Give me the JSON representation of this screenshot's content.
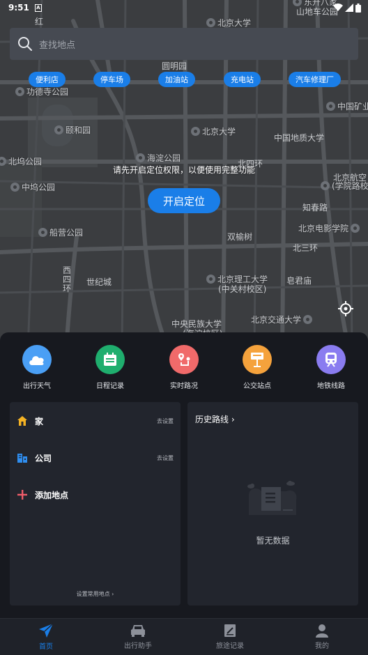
{
  "status_bar": {
    "time": "9:51",
    "app_badge": "A"
  },
  "search": {
    "placeholder": "查找地点"
  },
  "categories": [
    "便利店",
    "停车场",
    "加油站",
    "充电站",
    "汽车修理厂"
  ],
  "map": {
    "labels": [
      "东升八家",
      "山地车公园",
      "北京大学",
      "圆明园",
      "功德寺公园",
      "中国矿业",
      "颐和园",
      "北京大学",
      "中国地质大学",
      "北坞公园",
      "海淀公园",
      "北四环",
      "北京航空",
      "(学院路校",
      "中坞公园",
      "知春路",
      "船营公园",
      "北京电影学院",
      "双榆树",
      "北三环",
      "西四环",
      "世纪城",
      "北京理工大学",
      "(中关村校区)",
      "皂君庙",
      "中央民族大学",
      "(海淀校区)",
      "北京交通大学",
      "红"
    ]
  },
  "permission": {
    "message": "请先开启定位权限，以便使用完整功能",
    "button": "开启定位"
  },
  "quick_actions": [
    {
      "label": "出行天气",
      "icon": "cloud-icon",
      "color": "#4a9ff5"
    },
    {
      "label": "日程记录",
      "icon": "calendar-icon",
      "color": "#1fae6e"
    },
    {
      "label": "实时路况",
      "icon": "route-icon",
      "color": "#f06a6a"
    },
    {
      "label": "公交站点",
      "icon": "bus-stop-icon",
      "color": "#f5a23c"
    },
    {
      "label": "地铁线路",
      "icon": "subway-icon",
      "color": "#8a7cf0"
    }
  ],
  "places": {
    "home": {
      "label": "家",
      "action": "去设置"
    },
    "company": {
      "label": "公司",
      "action": "去设置"
    },
    "add": {
      "label": "添加地点"
    },
    "footer": "设置常用地点 ›"
  },
  "history": {
    "title": "历史路线 ›",
    "empty": "暂无数据"
  },
  "nav": [
    {
      "label": "首页",
      "icon": "paper-plane-icon",
      "active": true
    },
    {
      "label": "出行助手",
      "icon": "car-icon",
      "active": false
    },
    {
      "label": "旅途记录",
      "icon": "notebook-icon",
      "active": false
    },
    {
      "label": "我的",
      "icon": "user-icon",
      "active": false
    }
  ]
}
